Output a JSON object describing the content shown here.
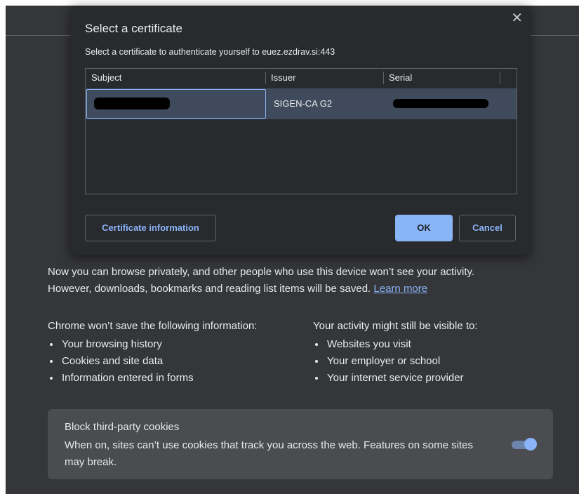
{
  "dialog": {
    "title": "Select a certificate",
    "close_glyph": "✕",
    "subtitle": "Select a certificate to authenticate yourself to euez.ezdrav.si:443",
    "columns": [
      "Subject",
      "Issuer",
      "Serial"
    ],
    "rows": [
      {
        "subject": "",
        "issuer": "SIGEN-CA G2",
        "serial": ""
      }
    ],
    "cert_info_label": "Certificate information",
    "ok_label": "OK",
    "cancel_label": "Cancel"
  },
  "incognito": {
    "para_line1": "Now you can browse privately, and other people who use this device won’t see your activity.",
    "para_line2": "However, downloads, bookmarks and reading list items will be saved.",
    "learn_more": "Learn more",
    "left_heading": "Chrome won’t save the following information:",
    "left_items": [
      "Your browsing history",
      "Cookies and site data",
      "Information entered in forms"
    ],
    "right_heading": "Your activity might still be visible to:",
    "right_items": [
      "Websites you visit",
      "Your employer or school",
      "Your internet service provider"
    ],
    "cookie_title": "Block third-party cookies",
    "cookie_desc": "When on, sites can’t use cookies that track you across the web. Features on some sites may break.",
    "cookie_toggle_on": true
  },
  "colors": {
    "accent": "#8ab4f8",
    "page_bg": "#35363a",
    "dialog_bg": "#292a2d",
    "selected_row": "#3f4b5d"
  }
}
